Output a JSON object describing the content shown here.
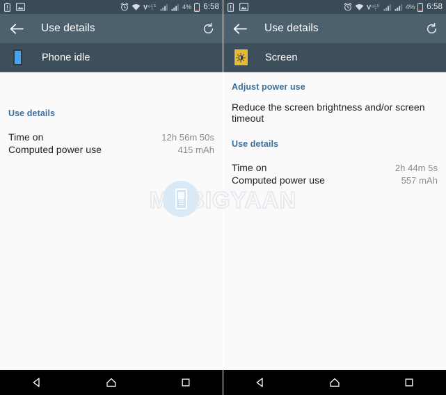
{
  "meta": {
    "watermark": {
      "text": "MOBIGYAAN",
      "icon": "phone-in-circle-icon"
    }
  },
  "panels": [
    {
      "id": "left",
      "status_bar": {
        "left_icons": [
          "battery-alert-icon",
          "screenshot-image-icon"
        ],
        "right_icons": [
          "alarm-clock-icon",
          "wifi-icon",
          "volte-icon",
          "signal-bars-sim1-icon",
          "signal-bars-sim2-icon",
          "battery-icon"
        ],
        "battery_percent": "4%",
        "time": "6:58"
      },
      "app_bar": {
        "back_label": "back-arrow",
        "title": "Use details",
        "refresh_label": "refresh"
      },
      "sub_header": {
        "icon": "phone-idle-icon",
        "title": "Phone idle"
      },
      "sections": {
        "use_details_label": "Use details",
        "rows": [
          {
            "label": "Time on",
            "value": "12h 56m 50s"
          },
          {
            "label": "Computed power use",
            "value": "415 mAh"
          }
        ]
      },
      "nav_bar": {
        "back": "back-triangle",
        "home": "home-pentagon",
        "recents": "recents-square"
      }
    },
    {
      "id": "right",
      "status_bar": {
        "left_icons": [
          "battery-alert-icon",
          "screenshot-image-icon"
        ],
        "right_icons": [
          "alarm-clock-icon",
          "wifi-icon",
          "volte-icon",
          "signal-bars-sim1-icon",
          "signal-bars-sim2-icon",
          "battery-icon"
        ],
        "battery_percent": "4%",
        "time": "6:58"
      },
      "app_bar": {
        "back_label": "back-arrow",
        "title": "Use details",
        "refresh_label": "refresh"
      },
      "sub_header": {
        "icon": "screen-brightness-icon",
        "title": "Screen"
      },
      "sections": {
        "adjust_power_use_label": "Adjust power use",
        "adjust_power_use_desc": "Reduce the screen brightness and/or screen timeout",
        "use_details_label": "Use details",
        "rows": [
          {
            "label": "Time on",
            "value": "2h 44m 5s"
          },
          {
            "label": "Computed power use",
            "value": "557 mAh"
          }
        ]
      },
      "nav_bar": {
        "back": "back-triangle",
        "home": "home-pentagon",
        "recents": "recents-square"
      }
    }
  ],
  "colors": {
    "status_bar": "#3b4a57",
    "app_bar": "#4d606e",
    "sub_header": "#3e4f5c",
    "content_bg": "#fafafa",
    "link_blue": "#3b6e9c",
    "phone_idle_accent": "#42a5f5",
    "screen_accent": "#e8bb31",
    "nav_bar": "#000000"
  }
}
